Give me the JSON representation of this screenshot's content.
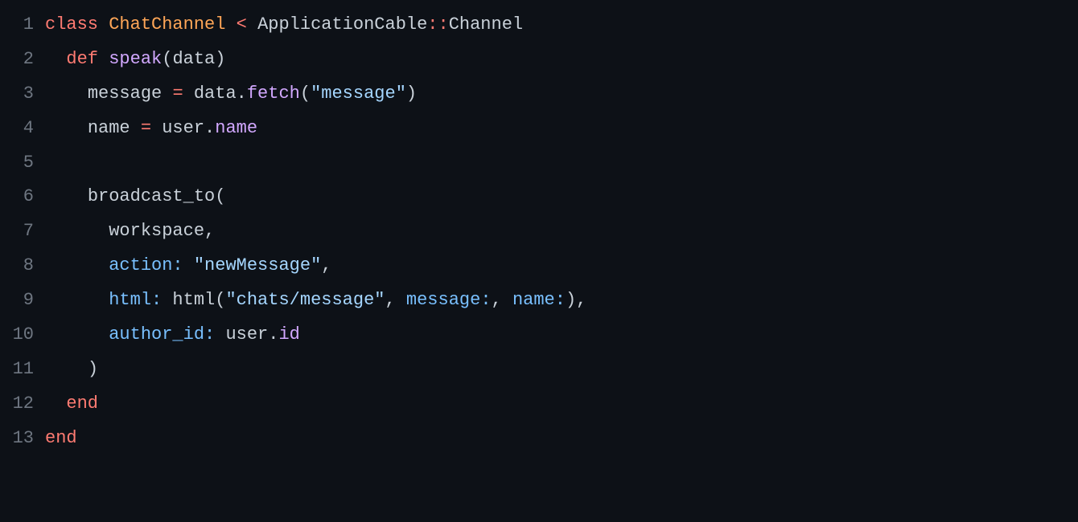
{
  "lines": [
    {
      "num": "1",
      "indent": 0,
      "tokens": [
        {
          "t": "class ",
          "c": "tok-keyword"
        },
        {
          "t": "ChatChannel",
          "c": "tok-class"
        },
        {
          "t": " < ",
          "c": "tok-op"
        },
        {
          "t": "ApplicationCable",
          "c": "tok-const"
        },
        {
          "t": "::",
          "c": "tok-op"
        },
        {
          "t": "Channel",
          "c": "tok-const"
        }
      ]
    },
    {
      "num": "2",
      "indent": 1,
      "tokens": [
        {
          "t": "def ",
          "c": "tok-keyword"
        },
        {
          "t": "speak",
          "c": "tok-method"
        },
        {
          "t": "(",
          "c": "tok-punc"
        },
        {
          "t": "data",
          "c": "tok-ident"
        },
        {
          "t": ")",
          "c": "tok-punc"
        }
      ]
    },
    {
      "num": "3",
      "indent": 2,
      "tokens": [
        {
          "t": "message ",
          "c": "tok-ident"
        },
        {
          "t": "=",
          "c": "tok-op"
        },
        {
          "t": " data",
          "c": "tok-ident"
        },
        {
          "t": ".",
          "c": "tok-punc"
        },
        {
          "t": "fetch",
          "c": "tok-method"
        },
        {
          "t": "(",
          "c": "tok-punc"
        },
        {
          "t": "\"message\"",
          "c": "tok-string"
        },
        {
          "t": ")",
          "c": "tok-punc"
        }
      ]
    },
    {
      "num": "4",
      "indent": 2,
      "tokens": [
        {
          "t": "name ",
          "c": "tok-ident"
        },
        {
          "t": "=",
          "c": "tok-op"
        },
        {
          "t": " user",
          "c": "tok-ident"
        },
        {
          "t": ".",
          "c": "tok-punc"
        },
        {
          "t": "name",
          "c": "tok-method"
        }
      ]
    },
    {
      "num": "5",
      "indent": 0,
      "tokens": []
    },
    {
      "num": "6",
      "indent": 2,
      "tokens": [
        {
          "t": "broadcast_to",
          "c": "tok-ident"
        },
        {
          "t": "(",
          "c": "tok-punc"
        }
      ]
    },
    {
      "num": "7",
      "indent": 3,
      "tokens": [
        {
          "t": "workspace",
          "c": "tok-ident"
        },
        {
          "t": ",",
          "c": "tok-punc"
        }
      ]
    },
    {
      "num": "8",
      "indent": 3,
      "tokens": [
        {
          "t": "action:",
          "c": "tok-symbol"
        },
        {
          "t": " ",
          "c": "tok-punc"
        },
        {
          "t": "\"newMessage\"",
          "c": "tok-string"
        },
        {
          "t": ",",
          "c": "tok-punc"
        }
      ]
    },
    {
      "num": "9",
      "indent": 3,
      "tokens": [
        {
          "t": "html:",
          "c": "tok-symbol"
        },
        {
          "t": " html",
          "c": "tok-ident"
        },
        {
          "t": "(",
          "c": "tok-punc"
        },
        {
          "t": "\"chats/message\"",
          "c": "tok-string"
        },
        {
          "t": ", ",
          "c": "tok-punc"
        },
        {
          "t": "message:",
          "c": "tok-symbol"
        },
        {
          "t": ", ",
          "c": "tok-punc"
        },
        {
          "t": "name:",
          "c": "tok-symbol"
        },
        {
          "t": ")",
          "c": "tok-punc"
        },
        {
          "t": ",",
          "c": "tok-punc"
        }
      ]
    },
    {
      "num": "10",
      "indent": 3,
      "tokens": [
        {
          "t": "author_id:",
          "c": "tok-symbol"
        },
        {
          "t": " user",
          "c": "tok-ident"
        },
        {
          "t": ".",
          "c": "tok-punc"
        },
        {
          "t": "id",
          "c": "tok-method"
        }
      ]
    },
    {
      "num": "11",
      "indent": 2,
      "tokens": [
        {
          "t": ")",
          "c": "tok-punc"
        }
      ]
    },
    {
      "num": "12",
      "indent": 1,
      "tokens": [
        {
          "t": "end",
          "c": "tok-keyword"
        }
      ]
    },
    {
      "num": "13",
      "indent": 0,
      "tokens": [
        {
          "t": "end",
          "c": "tok-keyword"
        }
      ]
    }
  ],
  "indent_unit": "  "
}
